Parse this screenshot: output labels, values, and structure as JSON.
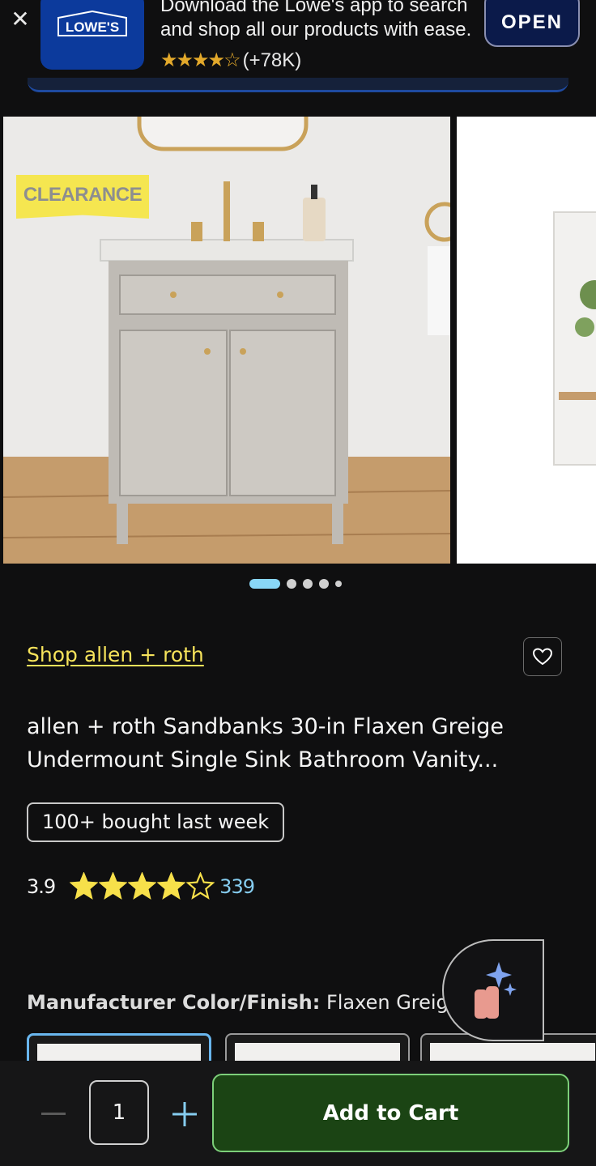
{
  "app_banner": {
    "close_icon": "close-icon",
    "logo_text": "LOWE'S",
    "message": "Download the Lowe's app to search and shop all our products with ease.",
    "stars": "★★★★☆",
    "rating_count": "(+78K)",
    "open_label": "OPEN",
    "colors": {
      "icon_bg": "#0c3a9c",
      "stars": "#e3a92b"
    }
  },
  "gallery": {
    "badge": "CLEARANCE",
    "image_count": 5,
    "active_index": 0
  },
  "product": {
    "brand_link": "Shop allen + roth",
    "title": "allen + roth Sandbanks 30-in Flaxen Greige Undermount Single Sink Bathroom Vanity...",
    "bought_badge": "100+ bought last week",
    "rating": "3.9",
    "rating_stars": 3.9,
    "review_count": "339",
    "color_label": "Manufacturer Color/Finish:",
    "color_value": "Flaxen Greige",
    "colors": {
      "brand_link": "#f6e35b",
      "review_link": "#86cdf0",
      "star": "#f7e04a"
    }
  },
  "cart_bar": {
    "quantity": "1",
    "add_label": "Add to Cart",
    "colors": {
      "button_bg": "#1b4414",
      "button_border": "#7dd07a",
      "plus": "#86cdf0"
    }
  }
}
